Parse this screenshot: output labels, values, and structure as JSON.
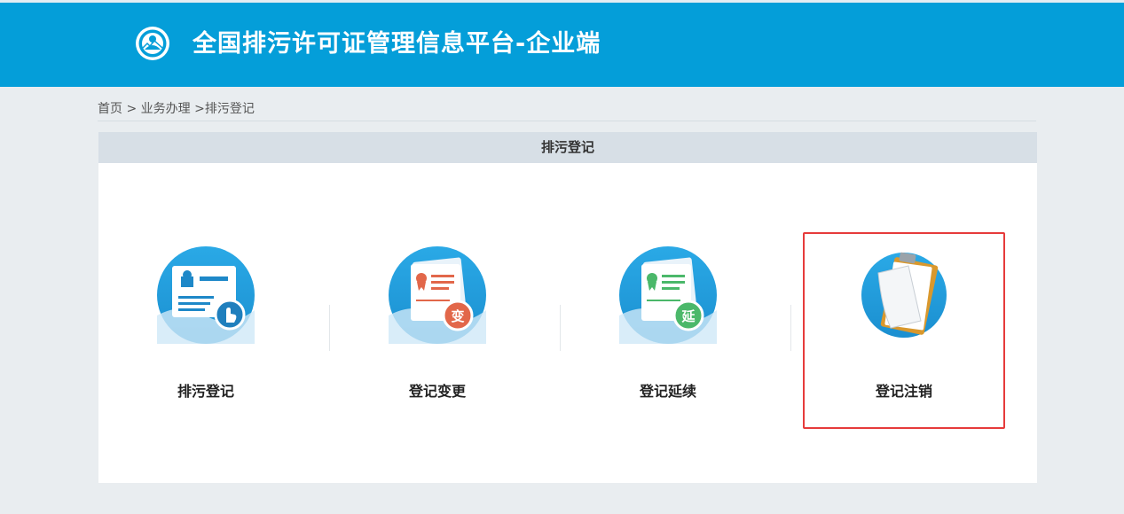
{
  "header": {
    "title": "全国排污许可证管理信息平台-企业端",
    "logo_icon": "ministry-emblem-icon",
    "background": "#049ed9"
  },
  "breadcrumb": {
    "items": [
      "首页",
      "业务办理",
      "排污登记"
    ],
    "separators": [
      " > ",
      " >"
    ]
  },
  "panel": {
    "title": "排污登记"
  },
  "cards": [
    {
      "label": "排污登记",
      "icon": "registration-card-icon"
    },
    {
      "label": "登记变更",
      "icon": "registration-change-icon",
      "badge": "变"
    },
    {
      "label": "登记延续",
      "icon": "registration-renewal-icon",
      "badge": "延"
    },
    {
      "label": "登记注销",
      "icon": "clipboard-cancel-icon",
      "selected": true
    }
  ],
  "colors": {
    "accent": "#049ed9",
    "selection": "#e63b3b",
    "change_badge": "#e2674a",
    "renewal_badge": "#4bb86a"
  }
}
